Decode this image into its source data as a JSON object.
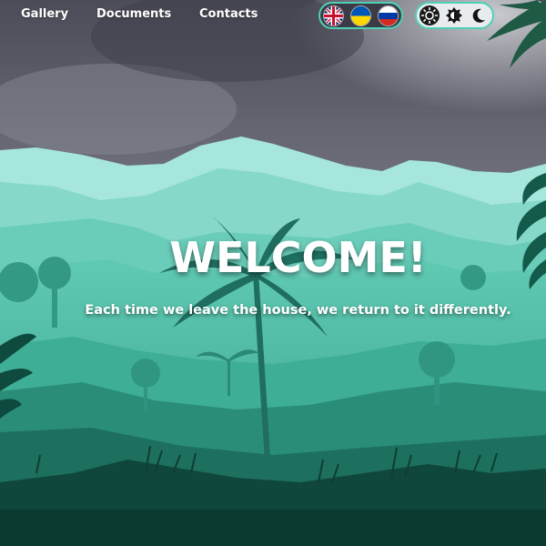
{
  "nav": {
    "links": [
      {
        "label": "Gallery"
      },
      {
        "label": "Documents"
      },
      {
        "label": "Contacts"
      }
    ]
  },
  "language_switcher": {
    "flags": [
      {
        "name": "uk-flag-icon",
        "country": "United Kingdom"
      },
      {
        "name": "ukraine-flag-icon",
        "country": "Ukraine"
      },
      {
        "name": "russia-flag-icon",
        "country": "Russia"
      }
    ]
  },
  "theme_switcher": {
    "options": [
      "light",
      "contrast",
      "dark"
    ],
    "selected": "light"
  },
  "hero": {
    "title": "WELCOME!",
    "subtitle": "Each time we leave the house, we return to it differently."
  },
  "colors": {
    "accent": "#4fd0b5",
    "sky": "#6e7080",
    "jungle_light": "#9fe3d8",
    "jungle_dark": "#0f3b33"
  }
}
